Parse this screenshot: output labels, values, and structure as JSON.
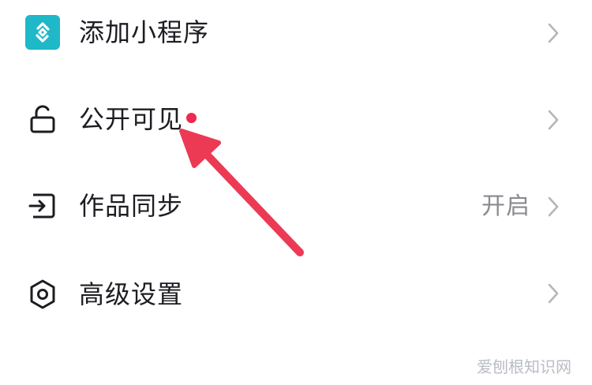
{
  "menu": {
    "items": [
      {
        "label": "添加小程序",
        "icon": "miniprogram-icon",
        "value": ""
      },
      {
        "label": "公开可见",
        "icon": "unlock-icon",
        "value": ""
      },
      {
        "label": "作品同步",
        "icon": "sync-export-icon",
        "value": "开启"
      },
      {
        "label": "高级设置",
        "icon": "hexagon-settings-icon",
        "value": ""
      }
    ]
  },
  "colors": {
    "accent_teal": "#1fb8c8",
    "notification_red": "#f0294e",
    "annotation_arrow": "#ec3a55",
    "text_primary": "#1c1c22",
    "text_secondary": "#8a8a90",
    "chevron": "#b5b5ba"
  },
  "watermark": {
    "text": "爱刨根知识网"
  }
}
